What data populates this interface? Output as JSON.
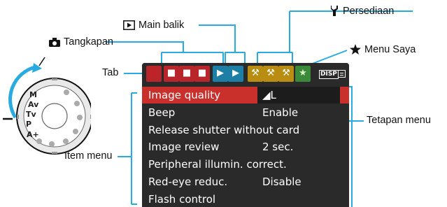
{
  "callouts": {
    "shoot": "Tangkapan",
    "play": "Main balik",
    "setup": "Persediaan",
    "mymenu": "Menu Saya",
    "tab": "Tab",
    "item": "Item menu",
    "setting": "Tetapan menu"
  },
  "tabs": [
    {
      "kind": "shoot",
      "glyph": "■",
      "active": true
    },
    {
      "kind": "shoot",
      "glyph": "■"
    },
    {
      "kind": "shoot",
      "glyph": "■"
    },
    {
      "kind": "shoot",
      "glyph": "■"
    },
    {
      "kind": "play",
      "glyph": "▶"
    },
    {
      "kind": "play",
      "glyph": "▶"
    },
    {
      "kind": "setup",
      "glyph": "⚒"
    },
    {
      "kind": "setup",
      "glyph": "⚒"
    },
    {
      "kind": "setup",
      "glyph": "⚒"
    },
    {
      "kind": "my",
      "glyph": "★"
    }
  ],
  "tab_icons": {
    "shoot": "camera-icon",
    "play": "playback-icon",
    "setup": "wrench-icon",
    "my": "star-icon"
  },
  "screen_icons": [
    "disp-button-icon",
    "menu-display-icon"
  ],
  "disp_text": "DISP",
  "menu": [
    {
      "name": "Image quality",
      "value": "◢L",
      "selected": true
    },
    {
      "name": "Beep",
      "value": "Enable"
    },
    {
      "name": "Release shutter without card",
      "value": ""
    },
    {
      "name": "Image review",
      "value": "2 sec."
    },
    {
      "name": "Peripheral illumin. correct.",
      "value": ""
    },
    {
      "name": "Red-eye reduc.",
      "value": "Disable"
    },
    {
      "name": "Flash control",
      "value": ""
    }
  ],
  "dial": {
    "marks": [
      "M",
      "Av",
      "Tv",
      "P",
      "A+"
    ]
  },
  "colors": {
    "shoot": "#b8262c",
    "play": "#1d7fa6",
    "setup": "#b98d12",
    "my": "#3b8a3c",
    "callout_line": "#29abe2",
    "highlight": "#c9302c"
  }
}
